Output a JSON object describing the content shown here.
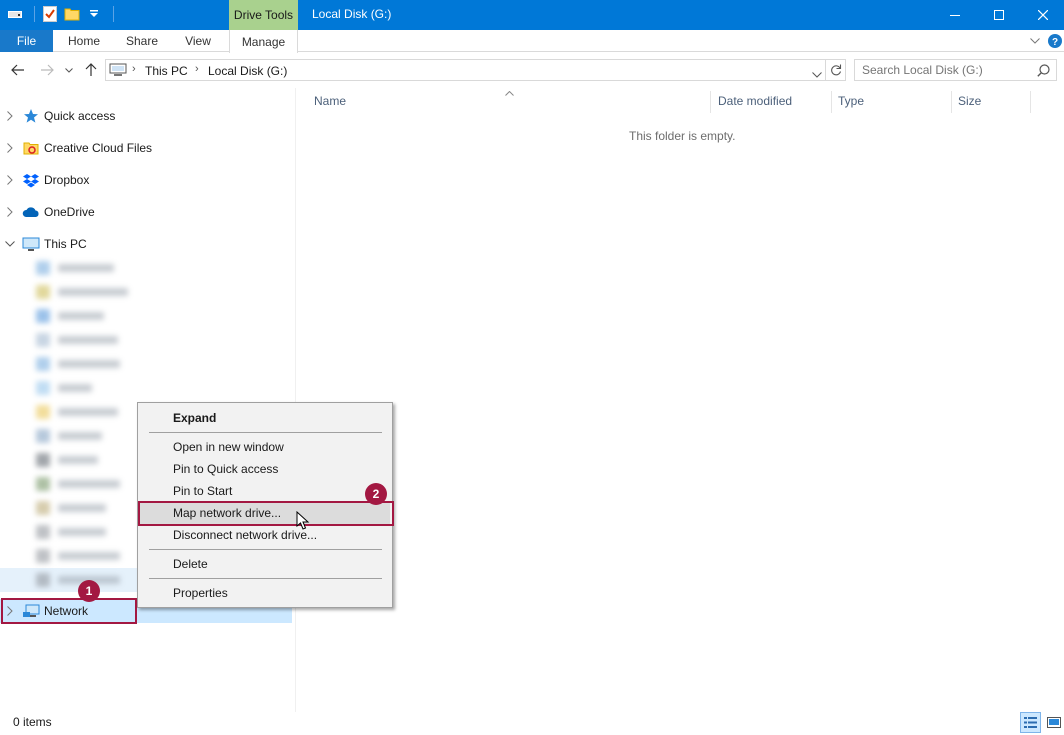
{
  "window": {
    "title": "Local Disk (G:)",
    "contextual_group": "Drive Tools",
    "accent_color": "#0078d7"
  },
  "ribbon": {
    "tabs": [
      "File",
      "Home",
      "Share",
      "View",
      "Manage"
    ]
  },
  "address": {
    "breadcrumb": [
      "This PC",
      "Local Disk (G:)"
    ],
    "search_placeholder": "Search Local Disk (G:)"
  },
  "nav": {
    "items": [
      {
        "label": "Quick access",
        "icon": "star-icon"
      },
      {
        "label": "Creative Cloud Files",
        "icon": "creative-cloud-icon"
      },
      {
        "label": "Dropbox",
        "icon": "dropbox-icon"
      },
      {
        "label": "OneDrive",
        "icon": "onedrive-icon"
      },
      {
        "label": "This PC",
        "icon": "computer-icon"
      }
    ],
    "network_label": "Network"
  },
  "columns": [
    "Name",
    "Date modified",
    "Type",
    "Size"
  ],
  "content": {
    "empty_message": "This folder is empty."
  },
  "context_menu": {
    "items": [
      "Expand",
      "Open in new window",
      "Pin to Quick access",
      "Pin to Start",
      "Map network drive...",
      "Disconnect network drive...",
      "Delete",
      "Properties"
    ]
  },
  "callouts": {
    "network_step": "1",
    "map_step": "2",
    "color": "#a31842"
  },
  "status": {
    "item_count": "0 items"
  }
}
